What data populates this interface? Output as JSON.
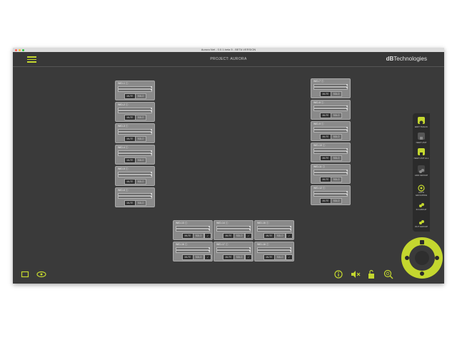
{
  "window": {
    "title": "Aurora Net - 0.0.1.beta 5 - BETA VERSION"
  },
  "appbar": {
    "project": "PROJECT: AURORA",
    "brand_bold": "dB",
    "brand_rest": "Technologies"
  },
  "colors": {
    "accent": "#c4d72f",
    "background": "#3a3a3a",
    "card": "#8a8a8a"
  },
  "buttons": {
    "mute": "MUTE",
    "solo": "SOLO"
  },
  "left_column": [
    {
      "title": "WID-1 ⓘ"
    },
    {
      "title": "WID-2 ⓘ"
    },
    {
      "title": "WID-3 ⓘ"
    },
    {
      "title": "WID-4 ⓘ"
    },
    {
      "title": "WID-5 ⓘ"
    },
    {
      "title": "WID-6 ⓘ"
    }
  ],
  "right_column": [
    {
      "title": "WID-7 ⓘ"
    },
    {
      "title": "WID-8 ⓘ"
    },
    {
      "title": "WID-9 ⓘ"
    },
    {
      "title": "WID-10 ⓘ"
    },
    {
      "title": "WID-11 ⓘ"
    },
    {
      "title": "WID-12 ⓘ"
    }
  ],
  "bottom_grid": [
    {
      "title": "WID-13 ⓘ"
    },
    {
      "title": "WID-14 ⓘ"
    },
    {
      "title": "WID-15 ⓘ"
    },
    {
      "title": "WID-16 ⓘ"
    },
    {
      "title": "WID-17 ⓘ"
    },
    {
      "title": "WID-18 ⓘ"
    }
  ],
  "side_panel": [
    {
      "label": "EDIT TRACK",
      "icon": "edit-track-icon"
    },
    {
      "label": "NEW UNIT",
      "icon": "new-unit-icon"
    },
    {
      "label": "NEW UNIT ALL",
      "icon": "new-unit-all-icon"
    },
    {
      "label": "ADD GROUP",
      "icon": "add-group-icon"
    },
    {
      "label": "AUTO GROUPING",
      "icon": "auto-grouping-icon"
    },
    {
      "label": "IN GROUP",
      "icon": "in-group-icon"
    },
    {
      "label": "OUT GROUP",
      "icon": "out-group-icon"
    }
  ],
  "footer_icons": [
    "frame-icon",
    "eye-icon",
    "info-icon",
    "mute-icon",
    "lock-icon",
    "search-icon"
  ]
}
